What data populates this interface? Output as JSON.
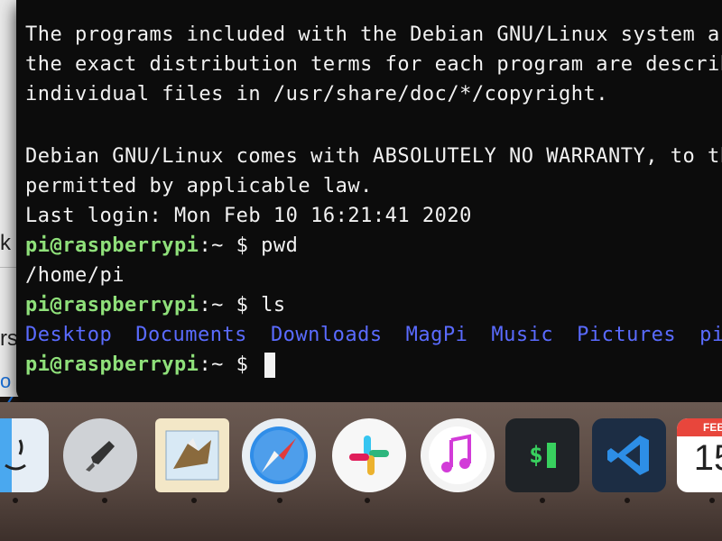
{
  "background_window": {
    "fragments": [
      "k",
      "rs",
      "o ∠"
    ]
  },
  "terminal": {
    "lines": [
      "The programs included with the Debian GNU/Linux system ar",
      "the exact distribution terms for each program are describ",
      "individual files in /usr/share/doc/*/copyright.",
      "Debian GNU/Linux comes with ABSOLUTELY NO WARRANTY, to the",
      "permitted by applicable law.",
      "Last login: Mon Feb 10 16:21:41 2020"
    ],
    "prompt_user": "pi@raspberrypi",
    "prompt_path": ":~ $ ",
    "cmd1": "pwd",
    "output1": "/home/pi",
    "cmd2": "ls",
    "ls_items": [
      "Desktop",
      "Documents",
      "Downloads",
      "MagPi",
      "Music",
      "Pictures",
      "pi-p"
    ]
  },
  "dock": {
    "calendar_month": "FEB",
    "calendar_day": "15",
    "apps": [
      "finder-icon",
      "launchpad-icon",
      "mail-icon",
      "safari-icon",
      "slack-icon",
      "music-icon",
      "terminal-icon",
      "vscode-icon",
      "calendar-icon"
    ],
    "terminal_glyph": "$"
  },
  "colors": {
    "prompt_green": "#8fe07a",
    "dir_blue": "#5a6bff",
    "terminal_bg": "#0c0c0c"
  }
}
